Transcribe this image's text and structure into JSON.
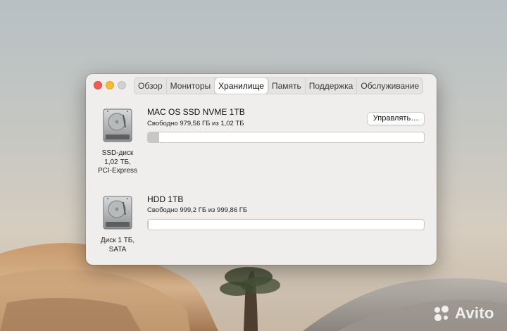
{
  "window": {
    "tabs": [
      {
        "label": "Обзор",
        "active": false
      },
      {
        "label": "Мониторы",
        "active": false
      },
      {
        "label": "Хранилище",
        "active": true
      },
      {
        "label": "Память",
        "active": false
      },
      {
        "label": "Поддержка",
        "active": false
      },
      {
        "label": "Обслуживание",
        "active": false
      }
    ]
  },
  "disks": [
    {
      "name": "MAC OS SSD NVME 1TB",
      "free_text": "Свободно 979,56 ГБ из 1,02 ТБ",
      "caption": [
        "SSD-диск",
        "1,02 ТБ,",
        "PCI-Express"
      ],
      "used_fraction": 0.04,
      "icon": "hard-drive-icon",
      "manage_label": "Управлять…"
    },
    {
      "name": "HDD 1TB",
      "free_text": "Свободно 999,2 ГБ из 999,86 ГБ",
      "caption": [
        "Диск 1 ТБ,",
        "SATA"
      ],
      "used_fraction": 0.003,
      "icon": "hard-drive-icon"
    }
  ],
  "watermark": {
    "text": "Avito"
  }
}
